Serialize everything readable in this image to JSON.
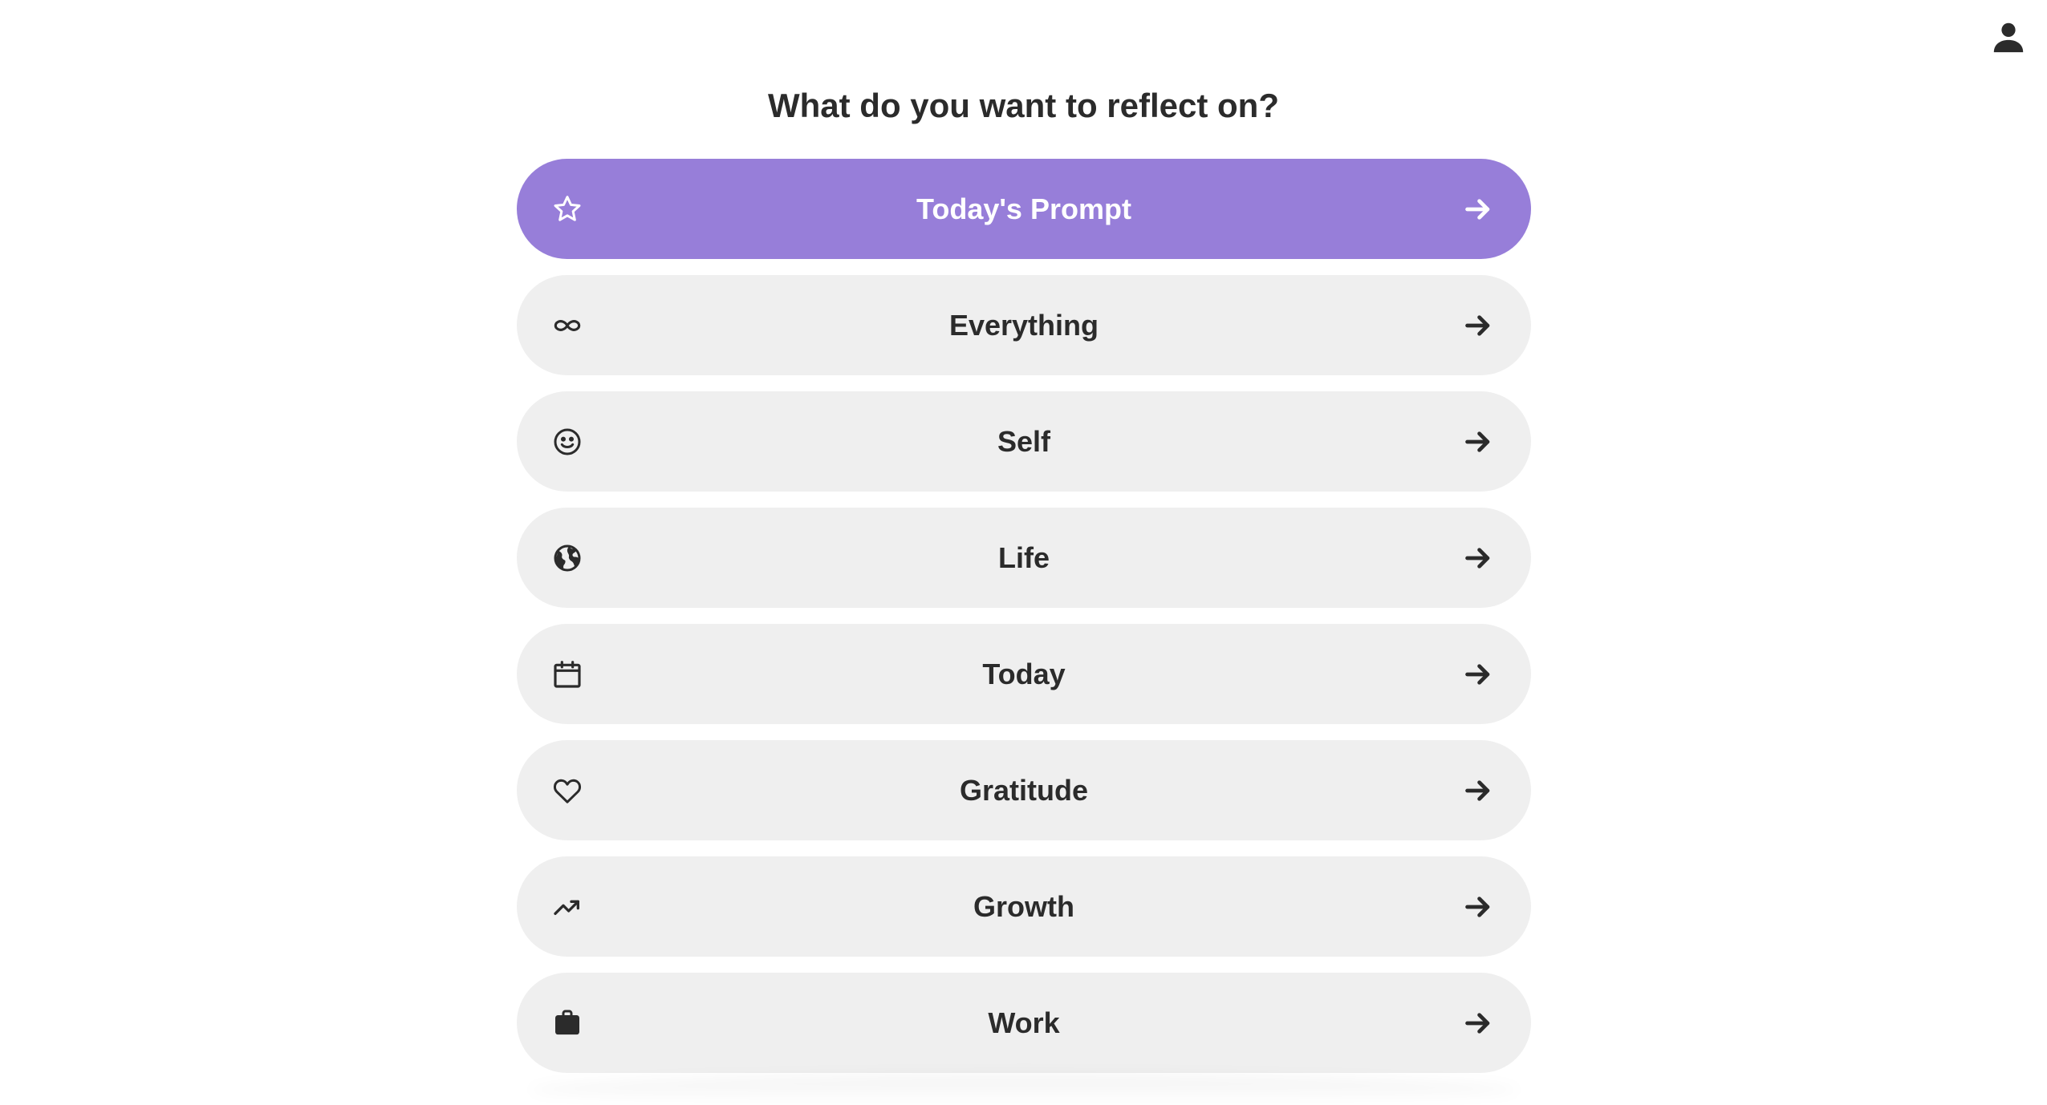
{
  "header": {
    "profile_icon": "person-icon"
  },
  "page": {
    "title": "What do you want to reflect on?"
  },
  "colors": {
    "accent": "#977ed9",
    "item_background": "#efefef",
    "text": "#2b2b2b"
  },
  "topics": [
    {
      "label": "Today's Prompt",
      "icon": "star-icon",
      "featured": true
    },
    {
      "label": "Everything",
      "icon": "infinity-icon",
      "featured": false
    },
    {
      "label": "Self",
      "icon": "smiley-icon",
      "featured": false
    },
    {
      "label": "Life",
      "icon": "globe-icon",
      "featured": false
    },
    {
      "label": "Today",
      "icon": "calendar-icon",
      "featured": false
    },
    {
      "label": "Gratitude",
      "icon": "heart-icon",
      "featured": false
    },
    {
      "label": "Growth",
      "icon": "trending-up-icon",
      "featured": false
    },
    {
      "label": "Work",
      "icon": "briefcase-icon",
      "featured": false
    }
  ]
}
